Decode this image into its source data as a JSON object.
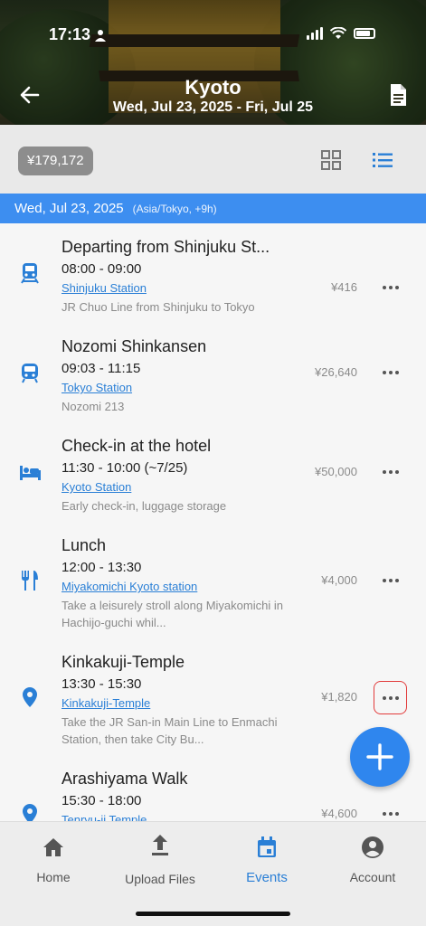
{
  "status_bar": {
    "time": "17:13"
  },
  "header": {
    "title": "Kyoto",
    "dates": "Wed, Jul 23, 2025 - Fri, Jul 25"
  },
  "toolbar": {
    "budget": "¥179,172"
  },
  "date_section": {
    "date": "Wed, Jul 23, 2025",
    "timezone": "(Asia/Tokyo, +9h)"
  },
  "events": [
    {
      "title": "Departing from Shinjuku St...",
      "time": "08:00 - 09:00",
      "location": "Shinjuku Station",
      "note": "JR Chuo Line from Shinjuku to Tokyo",
      "price": "¥416",
      "icon": "train-icon"
    },
    {
      "title": "Nozomi Shinkansen",
      "time": "09:03 - 11:15",
      "location": "Tokyo Station",
      "note": "Nozomi 213",
      "price": "¥26,640",
      "icon": "shinkansen-icon"
    },
    {
      "title": "Check-in at the hotel",
      "time": "11:30 - 10:00 (~7/25)",
      "location": "Kyoto Station",
      "note": "Early check-in, luggage storage",
      "price": "¥50,000",
      "icon": "hotel-bed-icon"
    },
    {
      "title": "Lunch",
      "time": "12:00 - 13:30",
      "location": "Miyakomichi Kyoto station",
      "note": "Take a leisurely stroll along Miyakomichi in Hachijo-guchi whil...",
      "price": "¥4,000",
      "icon": "restaurant-icon"
    },
    {
      "title": "Kinkakuji-Temple",
      "time": "13:30 - 15:30",
      "location": "Kinkakuji-Temple",
      "note": "Take the JR San-in Main Line to Enmachi Station, then take City Bu...",
      "price": "¥1,820",
      "icon": "location-pin-icon"
    },
    {
      "title": "Arashiyama Walk",
      "time": "15:30 - 18:00",
      "location": "Tenryu-ji Temple",
      "note": "",
      "price": "¥4,600",
      "icon": "location-pin-icon"
    }
  ],
  "bottom_nav": {
    "items": [
      {
        "label": "Home",
        "icon": "home-icon"
      },
      {
        "label": "Upload Files",
        "icon": "upload-icon"
      },
      {
        "label": "Events",
        "icon": "calendar-icon",
        "active": true
      },
      {
        "label": "Account",
        "icon": "account-icon"
      }
    ]
  },
  "colors": {
    "accent": "#3d8ef0",
    "link": "#2a7fd6",
    "budget_bg": "#8d8d8d",
    "highlight_border": "#e23b3b"
  }
}
